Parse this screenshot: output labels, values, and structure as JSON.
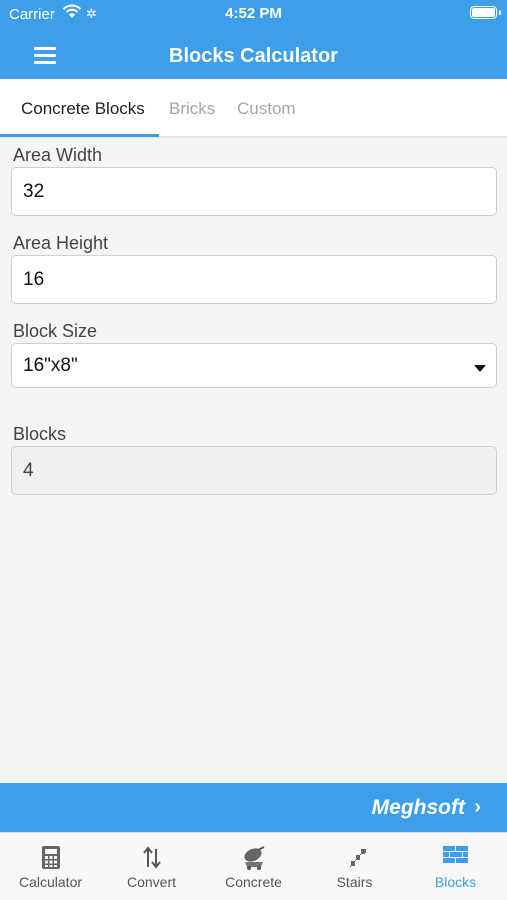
{
  "status_bar": {
    "carrier": "Carrier",
    "time": "4:52 PM"
  },
  "header": {
    "title": "Blocks Calculator"
  },
  "tabs": [
    {
      "label": "Concrete Blocks",
      "active": true
    },
    {
      "label": "Bricks",
      "active": false
    },
    {
      "label": "Custom",
      "active": false
    }
  ],
  "form": {
    "area_width": {
      "label": "Area Width",
      "value": "32"
    },
    "area_height": {
      "label": "Area Height",
      "value": "16"
    },
    "block_size": {
      "label": "Block Size",
      "value": "16\"x8\""
    },
    "blocks": {
      "label": "Blocks",
      "value": "4"
    }
  },
  "promo": {
    "brand": "Meghsoft",
    "chevron": "›"
  },
  "tab_bar": [
    {
      "label": "Calculator",
      "icon": "calculator-icon",
      "active": false
    },
    {
      "label": "Convert",
      "icon": "convert-arrows-icon",
      "active": false
    },
    {
      "label": "Concrete",
      "icon": "concrete-mixer-icon",
      "active": false
    },
    {
      "label": "Stairs",
      "icon": "stairs-icon",
      "active": false
    },
    {
      "label": "Blocks",
      "icon": "blocks-icon",
      "active": true
    }
  ],
  "colors": {
    "accent": "#3d9ee9",
    "inactive_tab": "#a7a7a7",
    "background": "#f5f5f5"
  }
}
